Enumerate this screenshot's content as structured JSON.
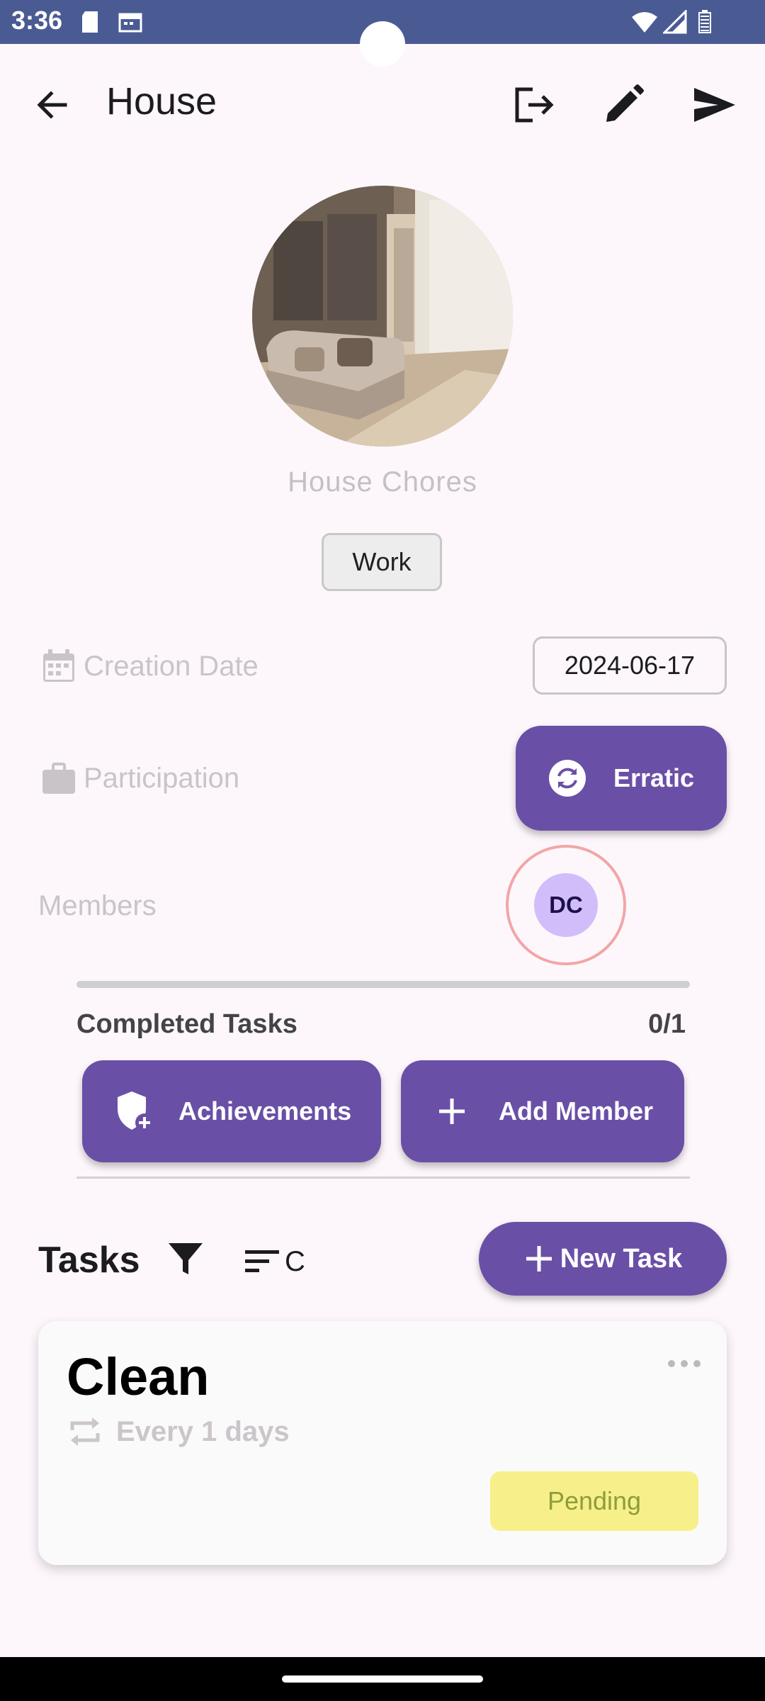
{
  "status_bar": {
    "time": "3:36"
  },
  "app_bar": {
    "title": "House"
  },
  "group": {
    "description": "House Chores",
    "category": "Work"
  },
  "creation": {
    "label": "Creation Date",
    "value": "2024-06-17"
  },
  "participation": {
    "label": "Participation",
    "button_label": "Erratic"
  },
  "members": {
    "label": "Members",
    "initials": "DC"
  },
  "progress": {
    "label": "Completed Tasks",
    "count": "0/1",
    "fraction": 0
  },
  "actions": {
    "achievements_label": "Achievements",
    "add_member_label": "Add Member"
  },
  "tasks": {
    "heading": "Tasks",
    "sort_label": "C",
    "new_task_label": "New Task",
    "items": [
      {
        "title": "Clean",
        "repeat": "Every 1 days",
        "status": "Pending"
      }
    ]
  },
  "colors": {
    "primary": "#6a4fa7",
    "status_bar": "#4a5b93",
    "pending_bg": "#f7f08a",
    "member_avatar": "#d2bdfb",
    "member_ring": "#f2a6a6"
  },
  "icons": {
    "back": "arrow-left-icon",
    "leave": "logout-icon",
    "edit": "pencil-icon",
    "share": "send-icon",
    "creation": "calendar-icon",
    "participation": "briefcase-icon",
    "participation_button": "sync-icon",
    "achievements": "shield-plus-icon",
    "add_member": "plus-icon",
    "filter": "filter-icon",
    "sort": "sort-icon",
    "task_menu": "more-horizontal-icon",
    "repeat": "repeat-icon"
  }
}
